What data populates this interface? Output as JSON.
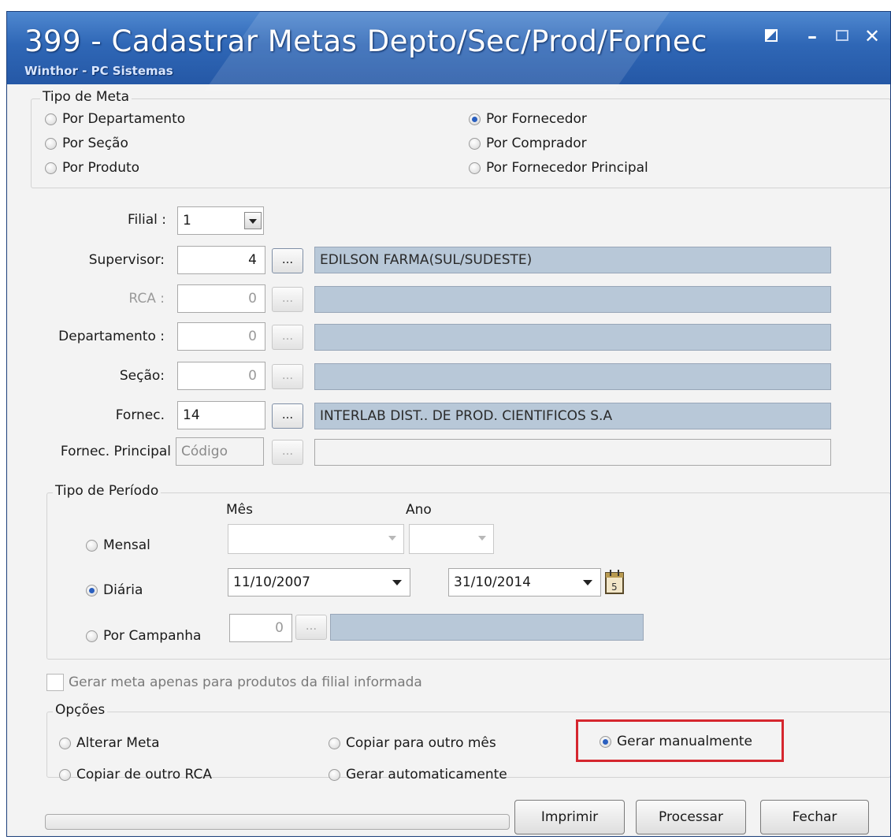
{
  "window": {
    "title": "399 - Cadastrar Metas Depto/Sec/Prod/Fornec",
    "subtitle": "Winthor - PC Sistemas"
  },
  "tipo_meta": {
    "title": "Tipo de Meta",
    "options": [
      {
        "label": "Por Departamento",
        "checked": false
      },
      {
        "label": "Por Seção",
        "checked": false
      },
      {
        "label": "Por Produto",
        "checked": false
      },
      {
        "label": "Por Fornecedor",
        "checked": true
      },
      {
        "label": "Por Comprador",
        "checked": false
      },
      {
        "label": "Por Fornecedor Principal",
        "checked": false
      }
    ]
  },
  "form": {
    "filial_label": "Filial :",
    "filial_value": "1",
    "supervisor_label": "Supervisor:",
    "supervisor_value": "4",
    "supervisor_desc": "EDILSON FARMA(SUL/SUDESTE)",
    "rca_label": "RCA :",
    "rca_value": "0",
    "departamento_label": "Departamento :",
    "departamento_value": "0",
    "secao_label": "Seção:",
    "secao_value": "0",
    "fornec_label": "Fornec.",
    "fornec_value": "14",
    "fornec_desc": "INTERLAB DIST.. DE PROD. CIENTIFICOS S.A",
    "fornec_principal_label": "Fornec. Principal",
    "fornec_principal_placeholder": "Código",
    "lookup_label": "..."
  },
  "periodo": {
    "title": "Tipo de Período",
    "mes_label": "Mês",
    "ano_label": "Ano",
    "mensal_label": "Mensal",
    "diaria_label": "Diária",
    "campanha_label": "Por Campanha",
    "selected": "Diária",
    "date_start": "11/10/2007",
    "date_end": "31/10/2014",
    "campanha_value": "0"
  },
  "checkbox_label": "Gerar meta apenas para produtos da filial informada",
  "opcoes": {
    "title": "Opções",
    "alterar_meta": "Alterar Meta",
    "copiar_rca": "Copiar de outro RCA",
    "copiar_mes": "Copiar para outro mês",
    "gerar_auto": "Gerar automaticamente",
    "gerar_manual": "Gerar manualmente",
    "selected": "Gerar manualmente"
  },
  "buttons": {
    "imprimir": "Imprimir",
    "processar": "Processar",
    "fechar": "Fechar"
  },
  "colors": {
    "title_bar": "#2f67b6",
    "desc_field": "#b8c8d8",
    "highlight": "#d5262e"
  }
}
